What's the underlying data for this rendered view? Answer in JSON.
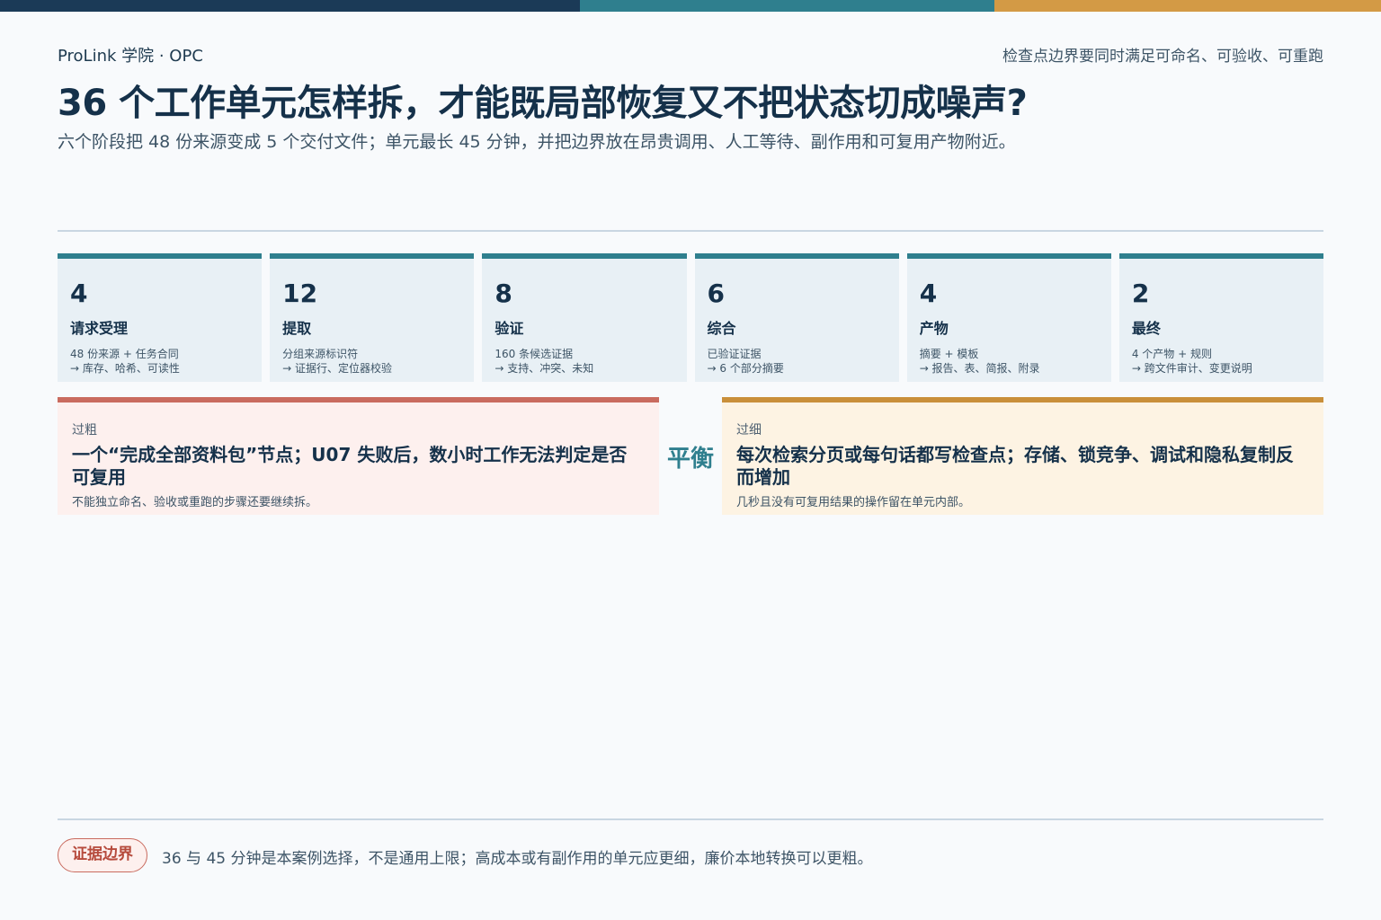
{
  "colors": {
    "navy": "#1b3a57",
    "teal": "#2f7f8e",
    "amber": "#d39a45",
    "coarse_red": "#c96b5f",
    "fine_gold": "#c98f3a"
  },
  "header": {
    "brand": "ProLink 学院 · OPC",
    "note": "检查点边界要同时满足可命名、可验收、可重跑",
    "title": "36 个工作单元怎样拆，才能既局部恢复又不把状态切成噪声?",
    "subtitle": "六个阶段把 48 份来源变成 5 个交付文件；单元最长 45 分钟，并把边界放在昂贵调用、人工等待、副作用和可复用产物附近。"
  },
  "stages": [
    {
      "count": "4",
      "name": "请求受理",
      "input": "48 份来源 + 任务合同",
      "output": "→ 库存、哈希、可读性"
    },
    {
      "count": "12",
      "name": "提取",
      "input": "分组来源标识符",
      "output": "→ 证据行、定位器校验"
    },
    {
      "count": "8",
      "name": "验证",
      "input": "160 条候选证据",
      "output": "→ 支持、冲突、未知"
    },
    {
      "count": "6",
      "name": "综合",
      "input": "已验证证据",
      "output": "→ 6 个部分摘要"
    },
    {
      "count": "4",
      "name": "产物",
      "input": "摘要 + 模板",
      "output": "→ 报告、表、简报、附录"
    },
    {
      "count": "2",
      "name": "最终",
      "input": "4 个产物 + 规则",
      "output": "→ 跨文件审计、变更说明"
    }
  ],
  "coarse": {
    "tag": "过粗",
    "headline": "一个“完成全部资料包”节点；U07 失败后，数小时工作无法判定是否可复用",
    "detail": "不能独立命名、验收或重跑的步骤还要继续拆。"
  },
  "balance": "平衡",
  "fine": {
    "tag": "过细",
    "headline": "每次检索分页或每句话都写检查点；存储、锁竞争、调试和隐私复制反而增加",
    "detail": "几秒且没有可复用结果的操作留在单元内部。"
  },
  "footer": {
    "badge": "证据边界",
    "text": "36 与 45 分钟是本案例选择，不是通用上限；高成本或有副作用的单元应更细，廉价本地转换可以更粗。"
  }
}
